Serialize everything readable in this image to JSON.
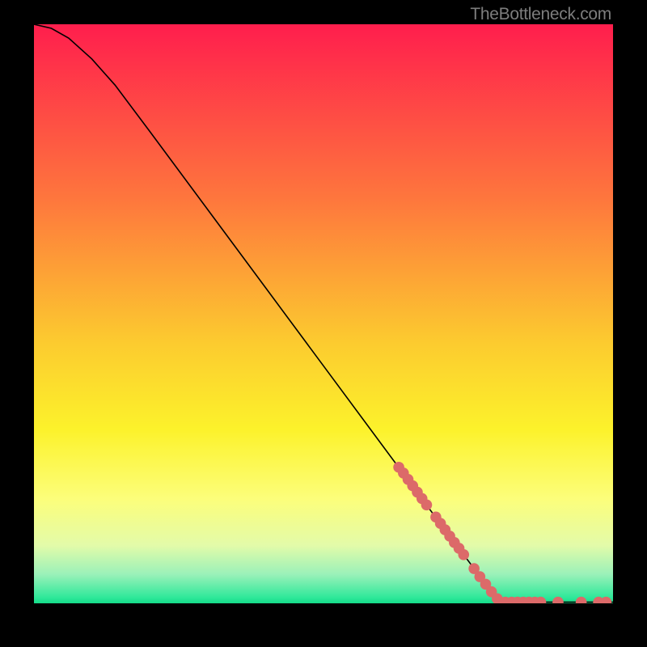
{
  "attribution": "TheBottleneck.com",
  "chart_data": {
    "type": "line",
    "title": "",
    "xlabel": "",
    "ylabel": "",
    "xlim": [
      0,
      100
    ],
    "ylim": [
      0,
      100
    ],
    "background_gradient": {
      "stops": [
        {
          "y": 0,
          "color": "#FF1E4D"
        },
        {
          "y": 30,
          "color": "#FE763D"
        },
        {
          "y": 55,
          "color": "#FCCB2F"
        },
        {
          "y": 70,
          "color": "#FCF22B"
        },
        {
          "y": 82,
          "color": "#FCFE7B"
        },
        {
          "y": 90,
          "color": "#E3FBA9"
        },
        {
          "y": 95,
          "color": "#9AF1B9"
        },
        {
          "y": 99,
          "color": "#2FE89A"
        },
        {
          "y": 100,
          "color": "#14DB88"
        }
      ]
    },
    "series": [
      {
        "name": "curve",
        "type": "line",
        "color": "#000000",
        "points": [
          {
            "x": 0,
            "y": 100.0
          },
          {
            "x": 3,
            "y": 99.3
          },
          {
            "x": 6,
            "y": 97.6
          },
          {
            "x": 10,
            "y": 94.0
          },
          {
            "x": 14,
            "y": 89.5
          },
          {
            "x": 20,
            "y": 81.5
          },
          {
            "x": 30,
            "y": 68.0
          },
          {
            "x": 40,
            "y": 54.5
          },
          {
            "x": 50,
            "y": 41.0
          },
          {
            "x": 60,
            "y": 27.5
          },
          {
            "x": 70,
            "y": 14.0
          },
          {
            "x": 76,
            "y": 6.0
          },
          {
            "x": 80,
            "y": 1.0
          },
          {
            "x": 82,
            "y": 0.2
          },
          {
            "x": 100,
            "y": 0.2
          }
        ]
      },
      {
        "name": "markers",
        "type": "scatter",
        "color": "#DC6A69",
        "points": [
          {
            "x": 63.0,
            "y": 23.5
          },
          {
            "x": 63.8,
            "y": 22.5
          },
          {
            "x": 64.6,
            "y": 21.4
          },
          {
            "x": 65.4,
            "y": 20.3
          },
          {
            "x": 66.2,
            "y": 19.2
          },
          {
            "x": 67.0,
            "y": 18.1
          },
          {
            "x": 67.8,
            "y": 17.0
          },
          {
            "x": 69.4,
            "y": 14.9
          },
          {
            "x": 70.2,
            "y": 13.8
          },
          {
            "x": 71.0,
            "y": 12.7
          },
          {
            "x": 71.8,
            "y": 11.6
          },
          {
            "x": 72.6,
            "y": 10.5
          },
          {
            "x": 73.4,
            "y": 9.5
          },
          {
            "x": 74.2,
            "y": 8.4
          },
          {
            "x": 76.0,
            "y": 6.0
          },
          {
            "x": 77.0,
            "y": 4.6
          },
          {
            "x": 78.0,
            "y": 3.3
          },
          {
            "x": 79.0,
            "y": 2.0
          },
          {
            "x": 80.0,
            "y": 0.8
          },
          {
            "x": 81.4,
            "y": 0.2
          },
          {
            "x": 82.5,
            "y": 0.2
          },
          {
            "x": 83.5,
            "y": 0.2
          },
          {
            "x": 84.5,
            "y": 0.2
          },
          {
            "x": 85.5,
            "y": 0.2
          },
          {
            "x": 86.5,
            "y": 0.2
          },
          {
            "x": 87.5,
            "y": 0.2
          },
          {
            "x": 90.5,
            "y": 0.2
          },
          {
            "x": 94.5,
            "y": 0.2
          },
          {
            "x": 97.5,
            "y": 0.2
          },
          {
            "x": 98.8,
            "y": 0.2
          }
        ]
      }
    ]
  }
}
